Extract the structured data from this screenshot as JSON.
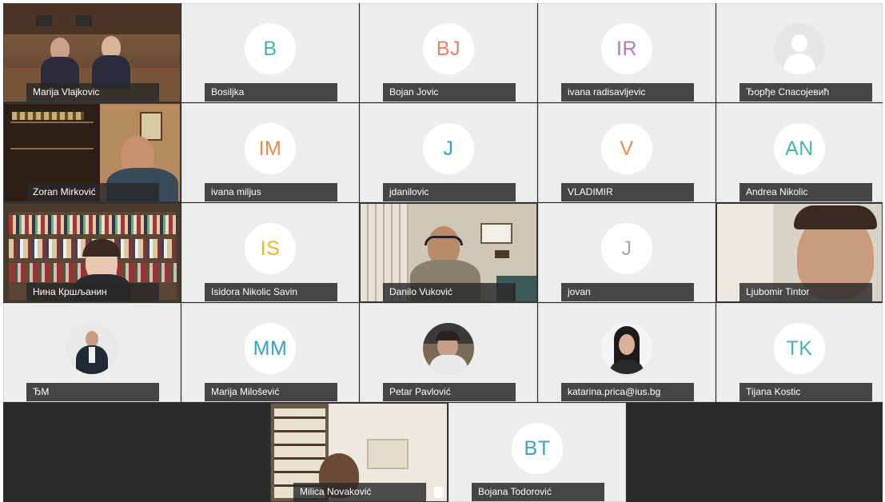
{
  "participants": [
    {
      "name": "Marija Vlajkovic"
    },
    {
      "name": "Bosiljka",
      "initials": "B",
      "color": "#4ab3b1"
    },
    {
      "name": "Bojan Jovic",
      "initials": "BJ",
      "color": "#e8826b"
    },
    {
      "name": "ivana radisavljevic",
      "initials": "IR",
      "color": "#b57bb5"
    },
    {
      "name": "Ђорђе Спасојевић"
    },
    {
      "name": "Zoran Mirković"
    },
    {
      "name": "ivana miljus",
      "initials": "IM",
      "color": "#ee8a4c"
    },
    {
      "name": "jdanilovic",
      "initials": "J",
      "color": "#3aa0c8"
    },
    {
      "name": "VLADIMIR",
      "initials": "V",
      "color": "#ee8a4c"
    },
    {
      "name": "Andrea Nikolic",
      "initials": "AN",
      "color": "#4ab3b1"
    },
    {
      "name": "Нина Кршљанин"
    },
    {
      "name": "Isidora Nikolic Savin",
      "initials": "IS",
      "color": "#e8b72e"
    },
    {
      "name": "Danilo Vuković"
    },
    {
      "name": "jovan",
      "initials": "J",
      "color": "#a8a8a8"
    },
    {
      "name": "Ljubomir Tintor"
    },
    {
      "name": "ЂМ"
    },
    {
      "name": "Marija Milošević",
      "initials": "MM",
      "color": "#3aa0c8"
    },
    {
      "name": "Petar Pavlović"
    },
    {
      "name": "katarina.prica@ius.bg"
    },
    {
      "name": "Tijana Kostic",
      "initials": "TK",
      "color": "#4ab3b1"
    },
    {
      "name": "Milica Novaković"
    },
    {
      "name": "Bojana Todorović",
      "initials": "BT",
      "color": "#3aa0c8"
    }
  ]
}
